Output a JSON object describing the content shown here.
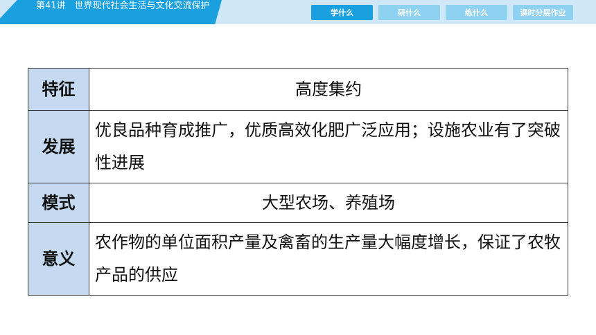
{
  "header": {
    "lesson_title": "第41讲　世界现代社会生活与文化交流保护"
  },
  "nav": {
    "items": [
      {
        "label": "学什么",
        "active": true
      },
      {
        "label": "研什么",
        "active": false
      },
      {
        "label": "练什么",
        "active": false
      },
      {
        "label": "课时分层作业",
        "active": false
      }
    ]
  },
  "table": {
    "rows": [
      {
        "label": "特征",
        "value": "高度集约"
      },
      {
        "label": "发展",
        "value": "优良品种育成推广，优质高效化肥广泛应用；设施农业有了突破性进展"
      },
      {
        "label": "模式",
        "value": "大型农场、养殖场"
      },
      {
        "label": "意义",
        "value": "农作物的单位面积产量及禽畜的生产量大幅度增长，保证了农牧产品的供应"
      }
    ]
  },
  "colors": {
    "banner": "#1aa0df",
    "topbar": "#cfe7f6",
    "nav_active": "#1aa0df",
    "nav_inactive": "#8fd1f1",
    "label_cell": "#c5d9f0"
  }
}
